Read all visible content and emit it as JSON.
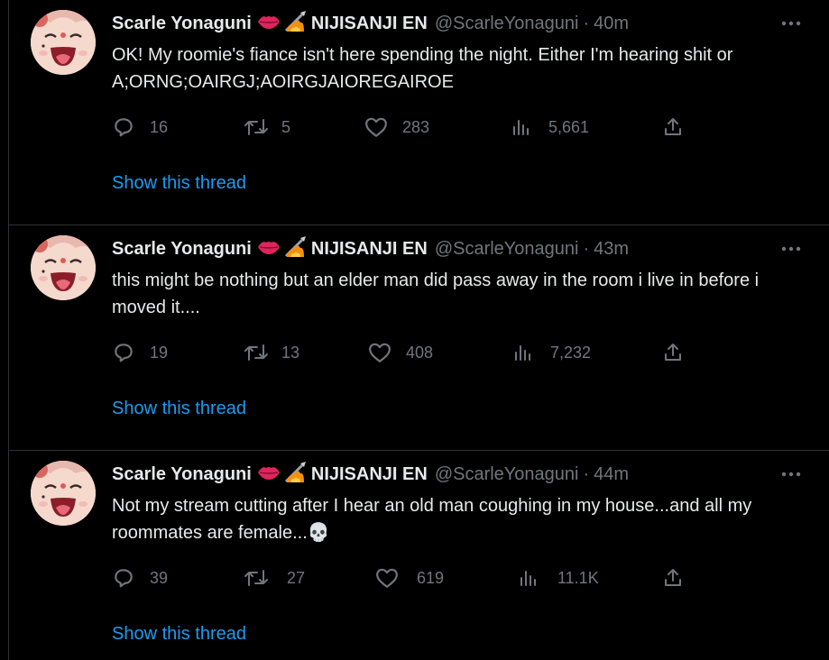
{
  "tweets": [
    {
      "name": "Scarle Yonaguni",
      "org": "NIJISANJI EN",
      "handle": "@ScarleYonaguni",
      "time": "40m",
      "text": "OK! My roomie's fiance isn't here spending the night. Either I'm hearing shit or A;ORNG;OAIRGJ;AOIRGJAIOREGAIROE",
      "replies": "16",
      "retweets": "5",
      "likes": "283",
      "views": "5,661",
      "show_thread": "Show this thread"
    },
    {
      "name": "Scarle Yonaguni",
      "org": "NIJISANJI EN",
      "handle": "@ScarleYonaguni",
      "time": "43m",
      "text": "this might be nothing but an elder man did pass away in the room i live in before i moved it....",
      "replies": "19",
      "retweets": "13",
      "likes": "408",
      "views": "7,232",
      "show_thread": "Show this thread"
    },
    {
      "name": "Scarle Yonaguni",
      "org": "NIJISANJI EN",
      "handle": "@ScarleYonaguni",
      "time": "44m",
      "text": "Not my stream cutting after I hear an old man coughing in my house...and all my roommates are female...💀",
      "replies": "39",
      "retweets": "27",
      "likes": "619",
      "views": "11.1K",
      "show_thread": "Show this thread"
    }
  ],
  "separator": "·",
  "colors": {
    "background": "#000000",
    "text": "#e7e9ea",
    "muted": "#71767b",
    "link": "#1d9bf0",
    "border": "#2f3336"
  },
  "icons": [
    "lips-icon",
    "torch-icon",
    "more-icon",
    "reply-icon",
    "retweet-icon",
    "like-icon",
    "views-icon",
    "share-icon"
  ]
}
